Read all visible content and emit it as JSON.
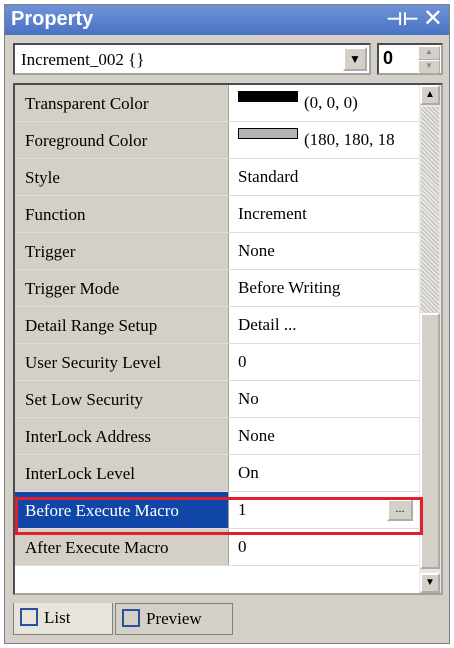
{
  "window": {
    "title": "Property"
  },
  "toolbar": {
    "object_value": "Increment_002 {}",
    "spin_value": "0"
  },
  "properties": [
    {
      "name": "Transparent Color",
      "value": "(0, 0, 0)",
      "swatch": "#000000"
    },
    {
      "name": "Foreground Color",
      "value": "(180, 180, 18",
      "swatch": "#b4b4b4"
    },
    {
      "name": "Style",
      "value": "Standard"
    },
    {
      "name": "Function",
      "value": "Increment"
    },
    {
      "name": "Trigger",
      "value": "None"
    },
    {
      "name": "Trigger Mode",
      "value": "Before Writing"
    },
    {
      "name": "Detail Range Setup",
      "value": "Detail ..."
    },
    {
      "name": "User Security Level",
      "value": "0"
    },
    {
      "name": "Set Low Security",
      "value": "No"
    },
    {
      "name": "InterLock Address",
      "value": "None"
    },
    {
      "name": "InterLock Level",
      "value": "On"
    },
    {
      "name": "Before Execute Macro",
      "value": "1",
      "selected": true,
      "button_label": "..."
    },
    {
      "name": "After Execute Macro",
      "value": "0"
    }
  ],
  "tabs": [
    {
      "label": "List"
    },
    {
      "label": "Preview"
    }
  ],
  "colors": {
    "title_bar": "#4a72c4",
    "selection": "#1046a8",
    "highlight_box": "#e0202c"
  }
}
